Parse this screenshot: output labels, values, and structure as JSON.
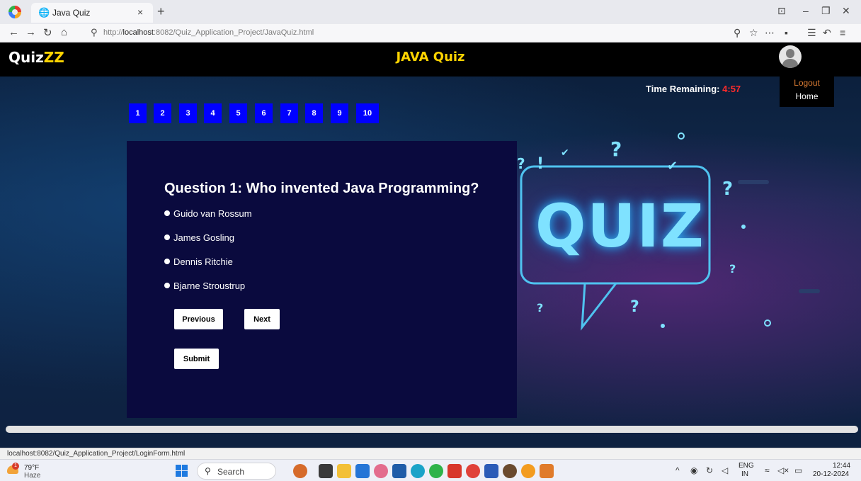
{
  "browser": {
    "tab_title": "Java Quiz",
    "tab_icon": "globe-icon",
    "url_prefix": "http://",
    "url_host": "localhost",
    "url_rest": ":8082/Quiz_Application_Project/JavaQuiz.html",
    "status_url": "localhost:8082/Quiz_Application_Project/LoginForm.html"
  },
  "navbar": {
    "brand_part1": "Quiz",
    "brand_part2": "ZZ",
    "title": "JAVA Quiz"
  },
  "user_menu": {
    "logout": "Logout",
    "home": "Home"
  },
  "timer": {
    "label": "Time Remaining:",
    "value": "4:57"
  },
  "question_nav": [
    "1",
    "2",
    "3",
    "4",
    "5",
    "6",
    "7",
    "8",
    "9",
    "10"
  ],
  "quiz": {
    "question": "Question 1: Who invented Java Programming?",
    "options": [
      "Guido van Rossum",
      "James Gosling",
      "Dennis Ritchie",
      "Bjarne Stroustrup"
    ],
    "previous_label": "Previous",
    "next_label": "Next",
    "submit_label": "Submit"
  },
  "hero_art": {
    "text": "QUIZ"
  },
  "taskbar": {
    "weather_temp": "79°F",
    "weather_condition": "Haze",
    "weather_badge": "1",
    "search_placeholder": "Search",
    "lang_top": "ENG",
    "lang_bottom": "IN",
    "time": "12:44",
    "date": "20-12-2024"
  },
  "colors": {
    "brand_accent": "#ffd400",
    "question_nav_bg": "#0000ff",
    "timer_value": "#ff2b2b",
    "card_bg": "#0a0a3e",
    "logout_text": "#d87a33"
  }
}
